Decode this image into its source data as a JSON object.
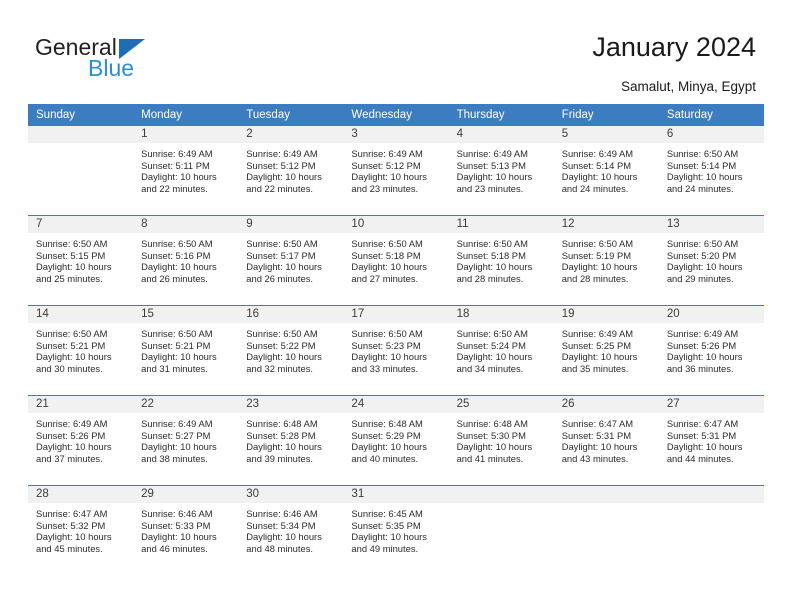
{
  "brand": {
    "name_part1": "General",
    "name_part2": "Blue",
    "triangle_color": "#1f6eb5",
    "blue_color": "#2b8fd4"
  },
  "header": {
    "title": "January 2024",
    "subtitle": "Samalut, Minya, Egypt"
  },
  "theme": {
    "header_row_bg": "#3b7dc0",
    "daynum_bg": "#f1f1f1",
    "grid_line": "#3b7dc0"
  },
  "weekdays": [
    "Sunday",
    "Monday",
    "Tuesday",
    "Wednesday",
    "Thursday",
    "Friday",
    "Saturday"
  ],
  "weeks": [
    [
      {
        "day": "",
        "sunrise": "",
        "sunset": "",
        "daylight1": "",
        "daylight2": ""
      },
      {
        "day": "1",
        "sunrise": "Sunrise: 6:49 AM",
        "sunset": "Sunset: 5:11 PM",
        "daylight1": "Daylight: 10 hours",
        "daylight2": "and 22 minutes."
      },
      {
        "day": "2",
        "sunrise": "Sunrise: 6:49 AM",
        "sunset": "Sunset: 5:12 PM",
        "daylight1": "Daylight: 10 hours",
        "daylight2": "and 22 minutes."
      },
      {
        "day": "3",
        "sunrise": "Sunrise: 6:49 AM",
        "sunset": "Sunset: 5:12 PM",
        "daylight1": "Daylight: 10 hours",
        "daylight2": "and 23 minutes."
      },
      {
        "day": "4",
        "sunrise": "Sunrise: 6:49 AM",
        "sunset": "Sunset: 5:13 PM",
        "daylight1": "Daylight: 10 hours",
        "daylight2": "and 23 minutes."
      },
      {
        "day": "5",
        "sunrise": "Sunrise: 6:49 AM",
        "sunset": "Sunset: 5:14 PM",
        "daylight1": "Daylight: 10 hours",
        "daylight2": "and 24 minutes."
      },
      {
        "day": "6",
        "sunrise": "Sunrise: 6:50 AM",
        "sunset": "Sunset: 5:14 PM",
        "daylight1": "Daylight: 10 hours",
        "daylight2": "and 24 minutes."
      }
    ],
    [
      {
        "day": "7",
        "sunrise": "Sunrise: 6:50 AM",
        "sunset": "Sunset: 5:15 PM",
        "daylight1": "Daylight: 10 hours",
        "daylight2": "and 25 minutes."
      },
      {
        "day": "8",
        "sunrise": "Sunrise: 6:50 AM",
        "sunset": "Sunset: 5:16 PM",
        "daylight1": "Daylight: 10 hours",
        "daylight2": "and 26 minutes."
      },
      {
        "day": "9",
        "sunrise": "Sunrise: 6:50 AM",
        "sunset": "Sunset: 5:17 PM",
        "daylight1": "Daylight: 10 hours",
        "daylight2": "and 26 minutes."
      },
      {
        "day": "10",
        "sunrise": "Sunrise: 6:50 AM",
        "sunset": "Sunset: 5:18 PM",
        "daylight1": "Daylight: 10 hours",
        "daylight2": "and 27 minutes."
      },
      {
        "day": "11",
        "sunrise": "Sunrise: 6:50 AM",
        "sunset": "Sunset: 5:18 PM",
        "daylight1": "Daylight: 10 hours",
        "daylight2": "and 28 minutes."
      },
      {
        "day": "12",
        "sunrise": "Sunrise: 6:50 AM",
        "sunset": "Sunset: 5:19 PM",
        "daylight1": "Daylight: 10 hours",
        "daylight2": "and 28 minutes."
      },
      {
        "day": "13",
        "sunrise": "Sunrise: 6:50 AM",
        "sunset": "Sunset: 5:20 PM",
        "daylight1": "Daylight: 10 hours",
        "daylight2": "and 29 minutes."
      }
    ],
    [
      {
        "day": "14",
        "sunrise": "Sunrise: 6:50 AM",
        "sunset": "Sunset: 5:21 PM",
        "daylight1": "Daylight: 10 hours",
        "daylight2": "and 30 minutes."
      },
      {
        "day": "15",
        "sunrise": "Sunrise: 6:50 AM",
        "sunset": "Sunset: 5:21 PM",
        "daylight1": "Daylight: 10 hours",
        "daylight2": "and 31 minutes."
      },
      {
        "day": "16",
        "sunrise": "Sunrise: 6:50 AM",
        "sunset": "Sunset: 5:22 PM",
        "daylight1": "Daylight: 10 hours",
        "daylight2": "and 32 minutes."
      },
      {
        "day": "17",
        "sunrise": "Sunrise: 6:50 AM",
        "sunset": "Sunset: 5:23 PM",
        "daylight1": "Daylight: 10 hours",
        "daylight2": "and 33 minutes."
      },
      {
        "day": "18",
        "sunrise": "Sunrise: 6:50 AM",
        "sunset": "Sunset: 5:24 PM",
        "daylight1": "Daylight: 10 hours",
        "daylight2": "and 34 minutes."
      },
      {
        "day": "19",
        "sunrise": "Sunrise: 6:49 AM",
        "sunset": "Sunset: 5:25 PM",
        "daylight1": "Daylight: 10 hours",
        "daylight2": "and 35 minutes."
      },
      {
        "day": "20",
        "sunrise": "Sunrise: 6:49 AM",
        "sunset": "Sunset: 5:26 PM",
        "daylight1": "Daylight: 10 hours",
        "daylight2": "and 36 minutes."
      }
    ],
    [
      {
        "day": "21",
        "sunrise": "Sunrise: 6:49 AM",
        "sunset": "Sunset: 5:26 PM",
        "daylight1": "Daylight: 10 hours",
        "daylight2": "and 37 minutes."
      },
      {
        "day": "22",
        "sunrise": "Sunrise: 6:49 AM",
        "sunset": "Sunset: 5:27 PM",
        "daylight1": "Daylight: 10 hours",
        "daylight2": "and 38 minutes."
      },
      {
        "day": "23",
        "sunrise": "Sunrise: 6:48 AM",
        "sunset": "Sunset: 5:28 PM",
        "daylight1": "Daylight: 10 hours",
        "daylight2": "and 39 minutes."
      },
      {
        "day": "24",
        "sunrise": "Sunrise: 6:48 AM",
        "sunset": "Sunset: 5:29 PM",
        "daylight1": "Daylight: 10 hours",
        "daylight2": "and 40 minutes."
      },
      {
        "day": "25",
        "sunrise": "Sunrise: 6:48 AM",
        "sunset": "Sunset: 5:30 PM",
        "daylight1": "Daylight: 10 hours",
        "daylight2": "and 41 minutes."
      },
      {
        "day": "26",
        "sunrise": "Sunrise: 6:47 AM",
        "sunset": "Sunset: 5:31 PM",
        "daylight1": "Daylight: 10 hours",
        "daylight2": "and 43 minutes."
      },
      {
        "day": "27",
        "sunrise": "Sunrise: 6:47 AM",
        "sunset": "Sunset: 5:31 PM",
        "daylight1": "Daylight: 10 hours",
        "daylight2": "and 44 minutes."
      }
    ],
    [
      {
        "day": "28",
        "sunrise": "Sunrise: 6:47 AM",
        "sunset": "Sunset: 5:32 PM",
        "daylight1": "Daylight: 10 hours",
        "daylight2": "and 45 minutes."
      },
      {
        "day": "29",
        "sunrise": "Sunrise: 6:46 AM",
        "sunset": "Sunset: 5:33 PM",
        "daylight1": "Daylight: 10 hours",
        "daylight2": "and 46 minutes."
      },
      {
        "day": "30",
        "sunrise": "Sunrise: 6:46 AM",
        "sunset": "Sunset: 5:34 PM",
        "daylight1": "Daylight: 10 hours",
        "daylight2": "and 48 minutes."
      },
      {
        "day": "31",
        "sunrise": "Sunrise: 6:45 AM",
        "sunset": "Sunset: 5:35 PM",
        "daylight1": "Daylight: 10 hours",
        "daylight2": "and 49 minutes."
      },
      {
        "day": "",
        "sunrise": "",
        "sunset": "",
        "daylight1": "",
        "daylight2": ""
      },
      {
        "day": "",
        "sunrise": "",
        "sunset": "",
        "daylight1": "",
        "daylight2": ""
      },
      {
        "day": "",
        "sunrise": "",
        "sunset": "",
        "daylight1": "",
        "daylight2": ""
      }
    ]
  ]
}
